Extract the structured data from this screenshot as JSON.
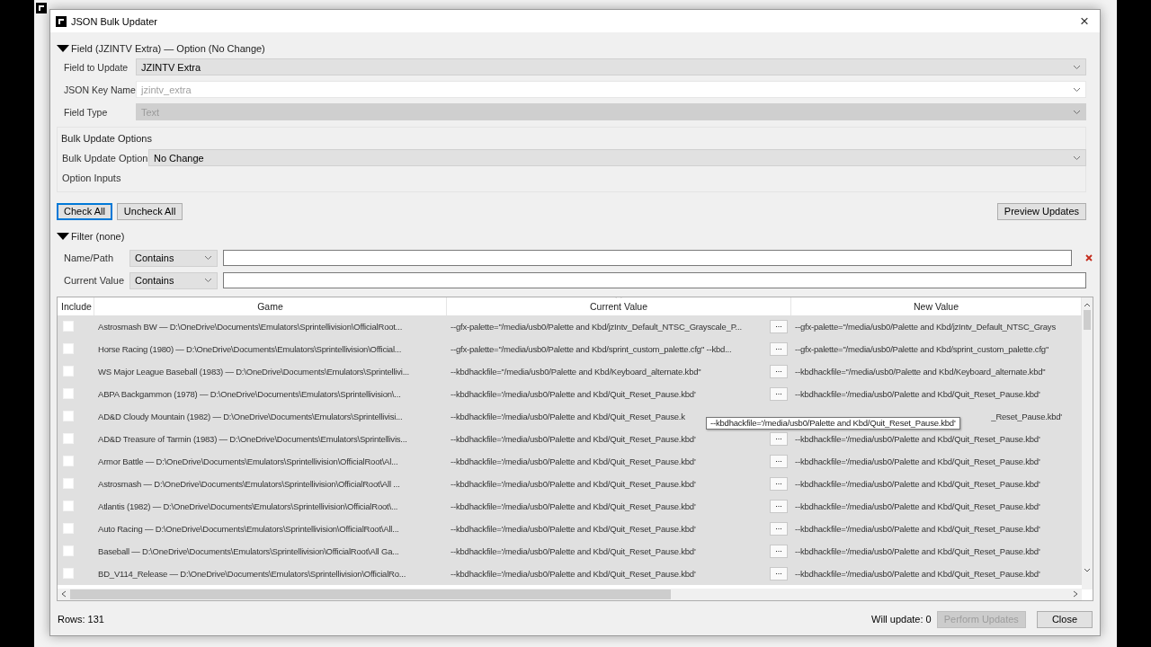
{
  "dialog": {
    "title": "JSON Bulk Updater",
    "close": "×"
  },
  "field_section": {
    "header": "Field (JZINTV Extra) — Option (No Change)",
    "expanded": true,
    "fields": [
      {
        "label": "Field to Update",
        "value": "JZINTV Extra",
        "kind": "dropdown",
        "disabled": false
      },
      {
        "label": "JSON Key Name",
        "value": "jzintv_extra",
        "kind": "editable",
        "disabled": true
      },
      {
        "label": "Field Type",
        "value": "Text",
        "kind": "dropdown",
        "disabled": true
      }
    ]
  },
  "bulk_options": {
    "title": "Bulk Update Options",
    "option_label": "Bulk Update Option",
    "option_value": "No Change",
    "inputs_label": "Option Inputs"
  },
  "actions": [
    {
      "label": "Check All",
      "focused": true
    },
    {
      "label": "Uncheck All",
      "focused": false
    }
  ],
  "preview_button": {
    "label": "Preview Updates"
  },
  "filter": {
    "header": "Filter (none)",
    "expanded": true,
    "rows": [
      {
        "label": "Name/Path",
        "mode": "Contains",
        "clearable": true
      },
      {
        "label": "Current Value",
        "mode": "Contains",
        "clearable": false
      }
    ]
  },
  "table": {
    "columns": [
      {
        "label": "Include",
        "sorted": false
      },
      {
        "label": "Game",
        "sorted": false
      },
      {
        "label": "Current Value",
        "sorted": true
      },
      {
        "label": "New Value",
        "sorted": false
      }
    ],
    "rows": [
      {
        "include": false,
        "game": "Astrosmash BW — D:\\OneDrive\\Documents\\Emulators\\Sprintellivision\\OfficialRoot...",
        "current": "--gfx-palette=\"/media/usb0/Palette and Kbd/jzIntv_Default_NTSC_Grayscale_P...",
        "button": "...",
        "new": "--gfx-palette=\"/media/usb0/Palette and Kbd/jzIntv_Default_NTSC_Grays"
      },
      {
        "include": false,
        "game": "Horse Racing (1980) — D:\\OneDrive\\Documents\\Emulators\\Sprintellivision\\Official...",
        "current": "--gfx-palette=\"/media/usb0/Palette and Kbd/sprint_custom_palette.cfg\" --kbd...",
        "button": "...",
        "new": "--gfx-palette=\"/media/usb0/Palette and Kbd/sprint_custom_palette.cfg\""
      },
      {
        "include": false,
        "game": "WS Major League Baseball (1983) — D:\\OneDrive\\Documents\\Emulators\\Sprintellivi...",
        "current": "--kbdhackfile=\"/media/usb0/Palette and Kbd/Keyboard_alternate.kbd\"",
        "button": "...",
        "new": "--kbdhackfile=\"/media/usb0/Palette and Kbd/Keyboard_alternate.kbd\""
      },
      {
        "include": false,
        "game": "ABPA Backgammon (1978) — D:\\OneDrive\\Documents\\Emulators\\Sprintellivision\\...",
        "current": "--kbdhackfile='/media/usb0/Palette and Kbd/Quit_Reset_Pause.kbd'",
        "button": "...",
        "new": "--kbdhackfile='/media/usb0/Palette and Kbd/Quit_Reset_Pause.kbd'"
      },
      {
        "include": false,
        "game": "AD&D Cloudy Mountain (1982) — D:\\OneDrive\\Documents\\Emulators\\Sprintellivisi...",
        "current": "--kbdhackfile='/media/usb0/Palette and Kbd/Quit_Reset_Pause.k",
        "new": "_Reset_Pause.kbd'"
      },
      {
        "include": false,
        "game": "AD&D Treasure of Tarmin (1983) — D:\\OneDrive\\Documents\\Emulators\\Sprintellivis...",
        "current": "--kbdhackfile='/media/usb0/Palette and Kbd/Quit_Reset_Pause.kbd'",
        "button": "...",
        "new": "--kbdhackfile='/media/usb0/Palette and Kbd/Quit_Reset_Pause.kbd'"
      },
      {
        "include": false,
        "game": "Armor Battle — D:\\OneDrive\\Documents\\Emulators\\Sprintellivision\\OfficialRoot\\Al...",
        "current": "--kbdhackfile='/media/usb0/Palette and Kbd/Quit_Reset_Pause.kbd'",
        "button": "...",
        "new": "--kbdhackfile='/media/usb0/Palette and Kbd/Quit_Reset_Pause.kbd'"
      },
      {
        "include": false,
        "game": "Astrosmash — D:\\OneDrive\\Documents\\Emulators\\Sprintellivision\\OfficialRoot\\All ...",
        "current": "--kbdhackfile='/media/usb0/Palette and Kbd/Quit_Reset_Pause.kbd'",
        "button": "...",
        "new": "--kbdhackfile='/media/usb0/Palette and Kbd/Quit_Reset_Pause.kbd'"
      },
      {
        "include": false,
        "game": "Atlantis (1982) — D:\\OneDrive\\Documents\\Emulators\\Sprintellivision\\OfficialRoot\\...",
        "current": "--kbdhackfile='/media/usb0/Palette and Kbd/Quit_Reset_Pause.kbd'",
        "button": "...",
        "new": "--kbdhackfile='/media/usb0/Palette and Kbd/Quit_Reset_Pause.kbd'"
      },
      {
        "include": false,
        "game": "Auto Racing — D:\\OneDrive\\Documents\\Emulators\\Sprintellivision\\OfficialRoot\\All...",
        "current": "--kbdhackfile='/media/usb0/Palette and Kbd/Quit_Reset_Pause.kbd'",
        "button": "...",
        "new": "--kbdhackfile='/media/usb0/Palette and Kbd/Quit_Reset_Pause.kbd'"
      },
      {
        "include": false,
        "game": "Baseball — D:\\OneDrive\\Documents\\Emulators\\Sprintellivision\\OfficialRoot\\All Ga...",
        "current": "--kbdhackfile='/media/usb0/Palette and Kbd/Quit_Reset_Pause.kbd'",
        "button": "...",
        "new": "--kbdhackfile='/media/usb0/Palette and Kbd/Quit_Reset_Pause.kbd'"
      },
      {
        "include": false,
        "game": "BD_V114_Release — D:\\OneDrive\\Documents\\Emulators\\Sprintellivision\\OfficialRo...",
        "current": "--kbdhackfile='/media/usb0/Palette and Kbd/Quit_Reset_Pause.kbd'",
        "button": "...",
        "new": "--kbdhackfile='/media/usb0/Palette and Kbd/Quit_Reset_Pause.kbd'"
      }
    ],
    "tooltip": {
      "text": "--kbdhackfile='/media/usb0/Palette and Kbd/Quit_Reset_Pause.kbd'"
    }
  },
  "status": {
    "rows": "Rows: 131",
    "will_update": "Will update: 0",
    "buttons": [
      {
        "label": "Perform Updates",
        "disabled": true
      },
      {
        "label": "Close",
        "disabled": false
      }
    ]
  }
}
